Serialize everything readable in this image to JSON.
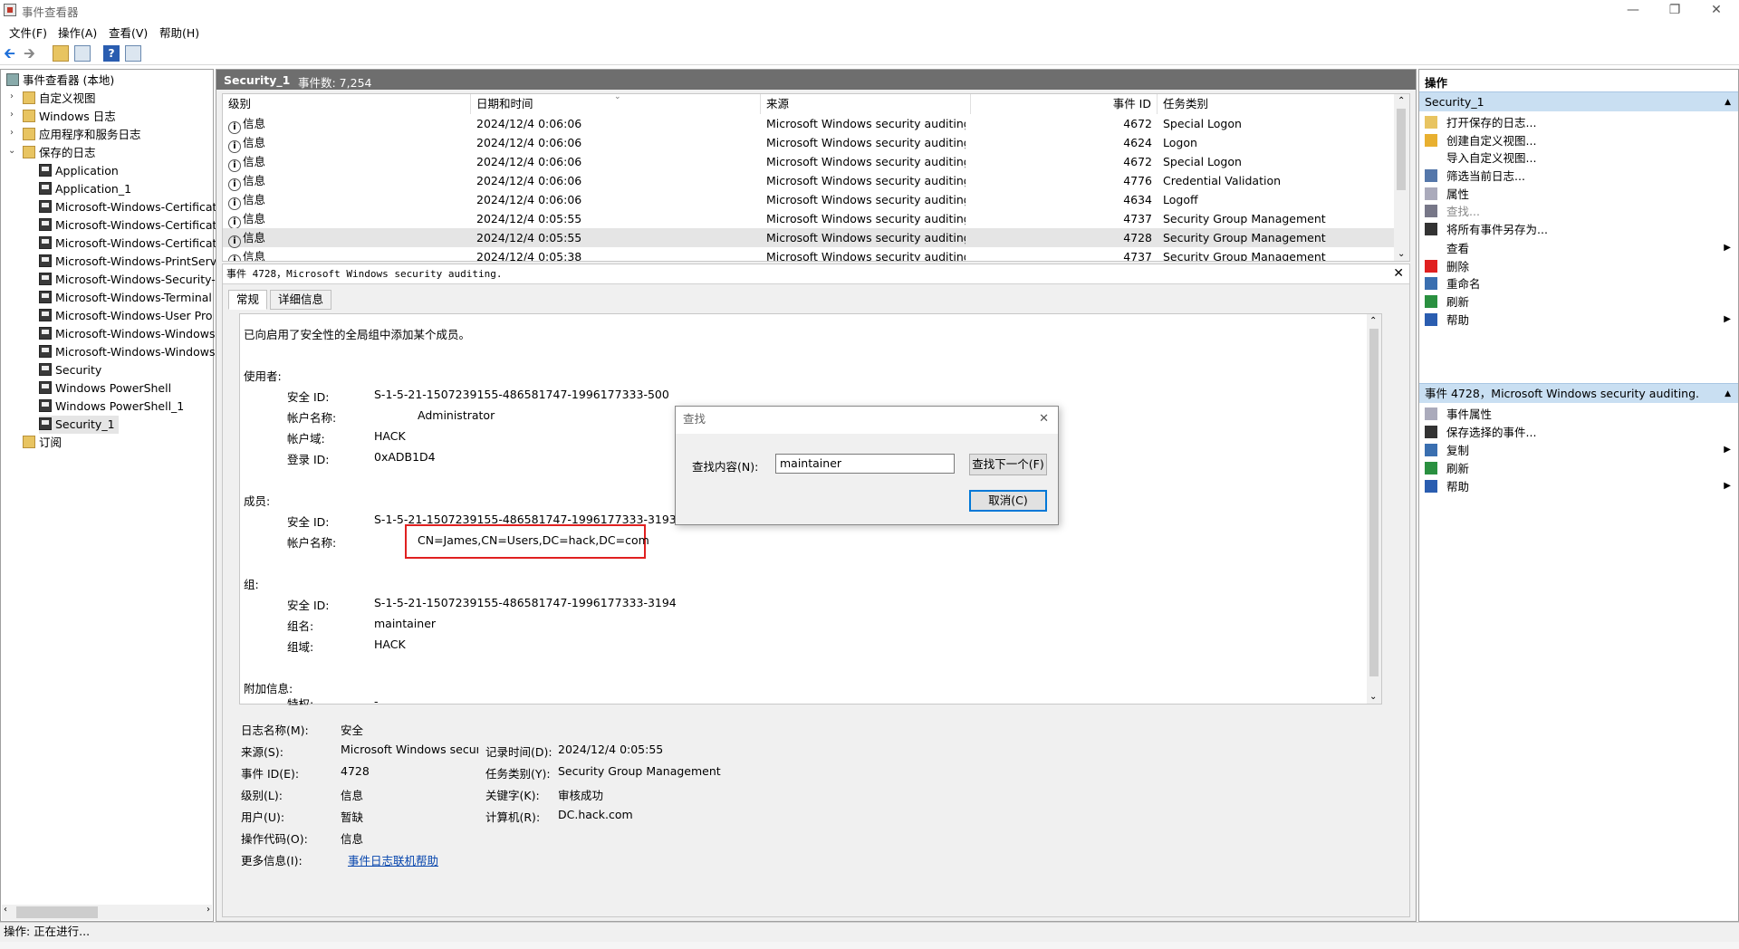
{
  "window": {
    "title": "事件查看器"
  },
  "menu": [
    "文件(F)",
    "操作(A)",
    "查看(V)",
    "帮助(H)"
  ],
  "tree": {
    "root": "事件查看器 (本地)",
    "items": [
      "自定义视图",
      "Windows 日志",
      "应用程序和服务日志",
      "保存的日志"
    ],
    "saved_logs": [
      "Application",
      "Application_1",
      "Microsoft-Windows-Certificat",
      "Microsoft-Windows-Certificat",
      "Microsoft-Windows-Certificat",
      "Microsoft-Windows-PrintServ",
      "Microsoft-Windows-Security-",
      "Microsoft-Windows-Terminal",
      "Microsoft-Windows-User Pro",
      "Microsoft-Windows-Windows",
      "Microsoft-Windows-Windows",
      "Security",
      "Windows PowerShell",
      "Windows PowerShell_1",
      "Security_1"
    ],
    "subscriptions": "订阅"
  },
  "log_header": {
    "name": "Security_1",
    "count": "事件数: 7,254"
  },
  "columns": [
    "级别",
    "日期和时间",
    "来源",
    "事件 ID",
    "任务类别"
  ],
  "events": [
    {
      "level": "信息",
      "time": "2024/12/4 0:06:06",
      "source": "Microsoft Windows security auditing.",
      "id": "4672",
      "task": "Special Logon"
    },
    {
      "level": "信息",
      "time": "2024/12/4 0:06:06",
      "source": "Microsoft Windows security auditing.",
      "id": "4624",
      "task": "Logon"
    },
    {
      "level": "信息",
      "time": "2024/12/4 0:06:06",
      "source": "Microsoft Windows security auditing.",
      "id": "4672",
      "task": "Special Logon"
    },
    {
      "level": "信息",
      "time": "2024/12/4 0:06:06",
      "source": "Microsoft Windows security auditing.",
      "id": "4776",
      "task": "Credential Validation"
    },
    {
      "level": "信息",
      "time": "2024/12/4 0:06:06",
      "source": "Microsoft Windows security auditing.",
      "id": "4634",
      "task": "Logoff"
    },
    {
      "level": "信息",
      "time": "2024/12/4 0:05:55",
      "source": "Microsoft Windows security auditing.",
      "id": "4737",
      "task": "Security Group Management"
    },
    {
      "level": "信息",
      "time": "2024/12/4 0:05:55",
      "source": "Microsoft Windows security auditing.",
      "id": "4728",
      "task": "Security Group Management"
    },
    {
      "level": "信息",
      "time": "2024/12/4 0:05:38",
      "source": "Microsoft Windows security auditing.",
      "id": "4737",
      "task": "Security Group Management"
    }
  ],
  "detail": {
    "header": "事件 4728，Microsoft Windows security auditing.",
    "tabs": [
      "常规",
      "详细信息"
    ],
    "message": {
      "intro": "已向启用了安全性的全局组中添加某个成员。",
      "subject_label": "使用者:",
      "subject": [
        [
          "安全 ID:",
          "S-1-5-21-1507239155-486581747-1996177333-500"
        ],
        [
          "帐户名称:",
          "Administrator"
        ],
        [
          "帐户域:",
          "HACK"
        ],
        [
          "登录 ID:",
          "0xADB1D4"
        ]
      ],
      "member_label": "成员:",
      "member": [
        [
          "安全 ID:",
          "S-1-5-21-1507239155-486581747-1996177333-3193"
        ],
        [
          "帐户名称:",
          "CN=James,CN=Users,DC=hack,DC=com"
        ]
      ],
      "group_label": "组:",
      "group": [
        [
          "安全 ID:",
          "S-1-5-21-1507239155-486581747-1996177333-3194"
        ],
        [
          "组名:",
          "maintainer"
        ],
        [
          "组域:",
          "HACK"
        ]
      ],
      "extra_label": "附加信息:",
      "extra": [
        [
          "特权:",
          "-"
        ]
      ]
    },
    "props": {
      "log_name_l": "日志名称(M):",
      "log_name": "安全",
      "source_l": "来源(S):",
      "source": "Microsoft Windows secur",
      "recorded_l": "记录时间(D):",
      "recorded": "2024/12/4 0:05:55",
      "event_id_l": "事件 ID(E):",
      "event_id": "4728",
      "task_l": "任务类别(Y):",
      "task": "Security Group Management",
      "level_l": "级别(L):",
      "level": "信息",
      "keywords_l": "关键字(K):",
      "keywords": "审核成功",
      "user_l": "用户(U):",
      "user": "暂缺",
      "computer_l": "计算机(R):",
      "computer": "DC.hack.com",
      "opcode_l": "操作代码(O):",
      "opcode": "信息",
      "more_l": "更多信息(I):",
      "more": "事件日志联机帮助"
    }
  },
  "find_dialog": {
    "title": "查找",
    "label": "查找内容(N):",
    "value": "maintainer",
    "find_next": "查找下一个(F)",
    "cancel": "取消(C)"
  },
  "actions": {
    "title": "操作",
    "section1": "Security_1",
    "items1": [
      "打开保存的日志...",
      "创建自定义视图...",
      "导入自定义视图...",
      "筛选当前日志...",
      "属性",
      "查找...",
      "将所有事件另存为...",
      "查看",
      "删除",
      "重命名",
      "刷新",
      "帮助"
    ],
    "section2": "事件 4728，Microsoft Windows security auditing.",
    "items2": [
      "事件属性",
      "保存选择的事件...",
      "复制",
      "刷新",
      "帮助"
    ]
  },
  "status": "操作: 正在进行..."
}
